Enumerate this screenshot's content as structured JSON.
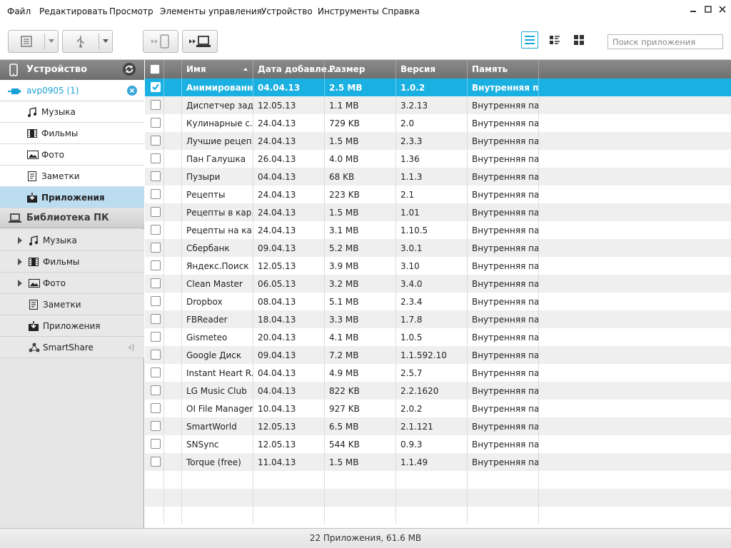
{
  "menu": [
    "Файл",
    "Редактировать",
    "Просмотр",
    "Элементы управления",
    "Устройство",
    "Инструменты",
    "Справка"
  ],
  "window": {
    "minimize_icon": "minimize-icon",
    "maximize_icon": "maximize-icon",
    "close_icon": "close-icon"
  },
  "search": {
    "placeholder": "Поиск приложения",
    "value": ""
  },
  "sidebar": {
    "device_header": "Устройство",
    "device_name": "avp0905 (1)",
    "device_items": [
      {
        "label": "Музыка",
        "icon": "music-icon"
      },
      {
        "label": "Фильмы",
        "icon": "film-icon"
      },
      {
        "label": "Фото",
        "icon": "photo-icon"
      },
      {
        "label": "Заметки",
        "icon": "notes-icon"
      },
      {
        "label": "Приложения",
        "icon": "apps-icon",
        "selected": true
      }
    ],
    "library_header": "Библиотека ПК",
    "library_items": [
      {
        "label": "Музыка",
        "icon": "music-icon",
        "expandable": true
      },
      {
        "label": "Фильмы",
        "icon": "film-icon",
        "expandable": true
      },
      {
        "label": "Фото",
        "icon": "photo-icon",
        "expandable": true
      },
      {
        "label": "Заметки",
        "icon": "notes-icon",
        "expandable": false
      },
      {
        "label": "Приложения",
        "icon": "apps-icon",
        "expandable": false
      },
      {
        "label": "SmartShare",
        "icon": "smartshare-icon",
        "expandable": false
      }
    ]
  },
  "table": {
    "columns": [
      "Имя",
      "Дата добавле...",
      "Размер",
      "Версия",
      "Память"
    ],
    "rows": [
      [
        "Анимированн...",
        "04.04.13",
        "2.5 MB",
        "1.0.2",
        "Внутренняя п..."
      ],
      [
        "Диспетчер задач",
        "12.05.13",
        "1.1 MB",
        "3.2.13",
        "Внутренняя па..."
      ],
      [
        "Кулинарные с...",
        "24.04.13",
        "729 KB",
        "2.0",
        "Внутренняя па..."
      ],
      [
        "Лучшие рецеп...",
        "24.04.13",
        "1.5 MB",
        "2.3.3",
        "Внутренняя па..."
      ],
      [
        "Пан Галушка",
        "26.04.13",
        "4.0 MB",
        "1.36",
        "Внутренняя па..."
      ],
      [
        "Пузыри",
        "04.04.13",
        "68 KB",
        "1.1.3",
        "Внутренняя па..."
      ],
      [
        "Рецепты",
        "24.04.13",
        "223 KB",
        "2.1",
        "Внутренняя па..."
      ],
      [
        "Рецепты в кар...",
        "24.04.13",
        "1.5 MB",
        "1.01",
        "Внутренняя па..."
      ],
      [
        "Рецепты на ка...",
        "24.04.13",
        "3.1 MB",
        "1.10.5",
        "Внутренняя па..."
      ],
      [
        "Сбербанк",
        "09.04.13",
        "5.2 MB",
        "3.0.1",
        "Внутренняя па..."
      ],
      [
        "Яндекс.Поиск",
        "12.05.13",
        "3.9 MB",
        "3.10",
        "Внутренняя па..."
      ],
      [
        "Clean Master",
        "06.05.13",
        "3.2 MB",
        "3.4.0",
        "Внутренняя па..."
      ],
      [
        "Dropbox",
        "08.04.13",
        "5.1 MB",
        "2.3.4",
        "Внутренняя па..."
      ],
      [
        "FBReader",
        "18.04.13",
        "3.3 MB",
        "1.7.8",
        "Внутренняя па..."
      ],
      [
        "Gismeteo",
        "20.04.13",
        "4.1 MB",
        "1.0.5",
        "Внутренняя па..."
      ],
      [
        "Google Диск",
        "09.04.13",
        "7.2 MB",
        "1.1.592.10",
        "Внутренняя па..."
      ],
      [
        "Instant Heart R...",
        "04.04.13",
        "4.9 MB",
        "2.5.7",
        "Внутренняя па..."
      ],
      [
        "LG Music Club",
        "04.04.13",
        "822 KB",
        "2.2.1620",
        "Внутренняя па..."
      ],
      [
        "OI File Manager",
        "10.04.13",
        "927 KB",
        "2.0.2",
        "Внутренняя па..."
      ],
      [
        "SmartWorld",
        "12.05.13",
        "6.5 MB",
        "2.1.121",
        "Внутренняя па..."
      ],
      [
        "SNSync",
        "12.05.13",
        "544 KB",
        "0.9.3",
        "Внутренняя па..."
      ],
      [
        "Torque (free)",
        "11.04.13",
        "1.5 MB",
        "1.1.49",
        "Внутренняя па..."
      ]
    ],
    "selected_row": 0
  },
  "status": "22 Приложения, 61.6 MB",
  "colors": {
    "accent": "#1ab0e2",
    "header_gray": "#7d7d7d",
    "selected_side": "#bcdcf0"
  }
}
